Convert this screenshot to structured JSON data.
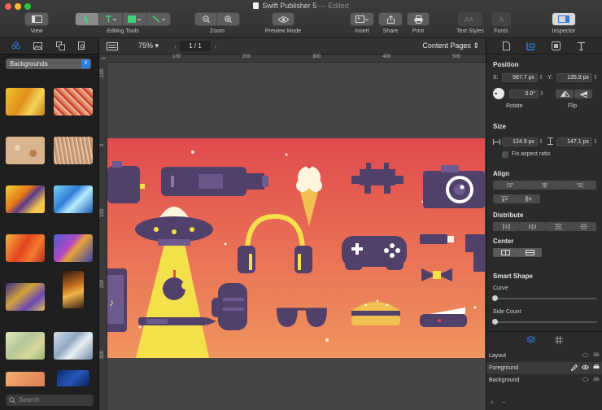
{
  "window": {
    "app_title": "Swift Publisher 5",
    "separator": "—",
    "status": "Edited"
  },
  "toolbar": {
    "view": "View",
    "editing_tools": "Editing Tools",
    "zoom": "Zoom",
    "preview_mode": "Preview Mode",
    "insert": "Insert",
    "share": "Share",
    "print": "Print",
    "text_styles": "Text Styles",
    "fonts": "Fonts",
    "inspector": "Inspector"
  },
  "left_panel": {
    "category": "Backgrounds",
    "search_placeholder": "Search"
  },
  "canvas_bar": {
    "zoom": "75%",
    "page": "1 / 1",
    "content_pages": "Content Pages"
  },
  "rulers": {
    "unit": "px",
    "h_ticks": [
      "100",
      "200",
      "300",
      "400",
      "500"
    ],
    "v_ticks": [
      "-100",
      "0",
      "100",
      "200",
      "300"
    ]
  },
  "inspector": {
    "position": {
      "title": "Position",
      "x_label": "X:",
      "x_value": "567.7 px",
      "y_label": "Y:",
      "y_value": "135.9 px",
      "rotate_value": "0.0°",
      "rotate_label": "Rotate",
      "flip_label": "Flip"
    },
    "size": {
      "title": "Size",
      "width": "124.9 px",
      "height": "147.1 px",
      "fix_aspect": "Fix aspect ratio"
    },
    "align_title": "Align",
    "distribute_title": "Distribute",
    "center_title": "Center",
    "smart_shape": {
      "title": "Smart Shape",
      "curve_label": "Curve",
      "side_count_label": "Side Count",
      "curve_level": 0,
      "side_count_level": 0
    }
  },
  "layers": {
    "items": [
      {
        "label": "Layout"
      },
      {
        "label": "Foreground"
      },
      {
        "label": "Background"
      }
    ],
    "add": "+",
    "remove": "−"
  },
  "colors": {
    "accent": "#2f7de0",
    "art_top": "#e14a4d",
    "art_bottom": "#f0955e",
    "art_purple": "#50406a",
    "art_beam": "#f4e04a"
  }
}
